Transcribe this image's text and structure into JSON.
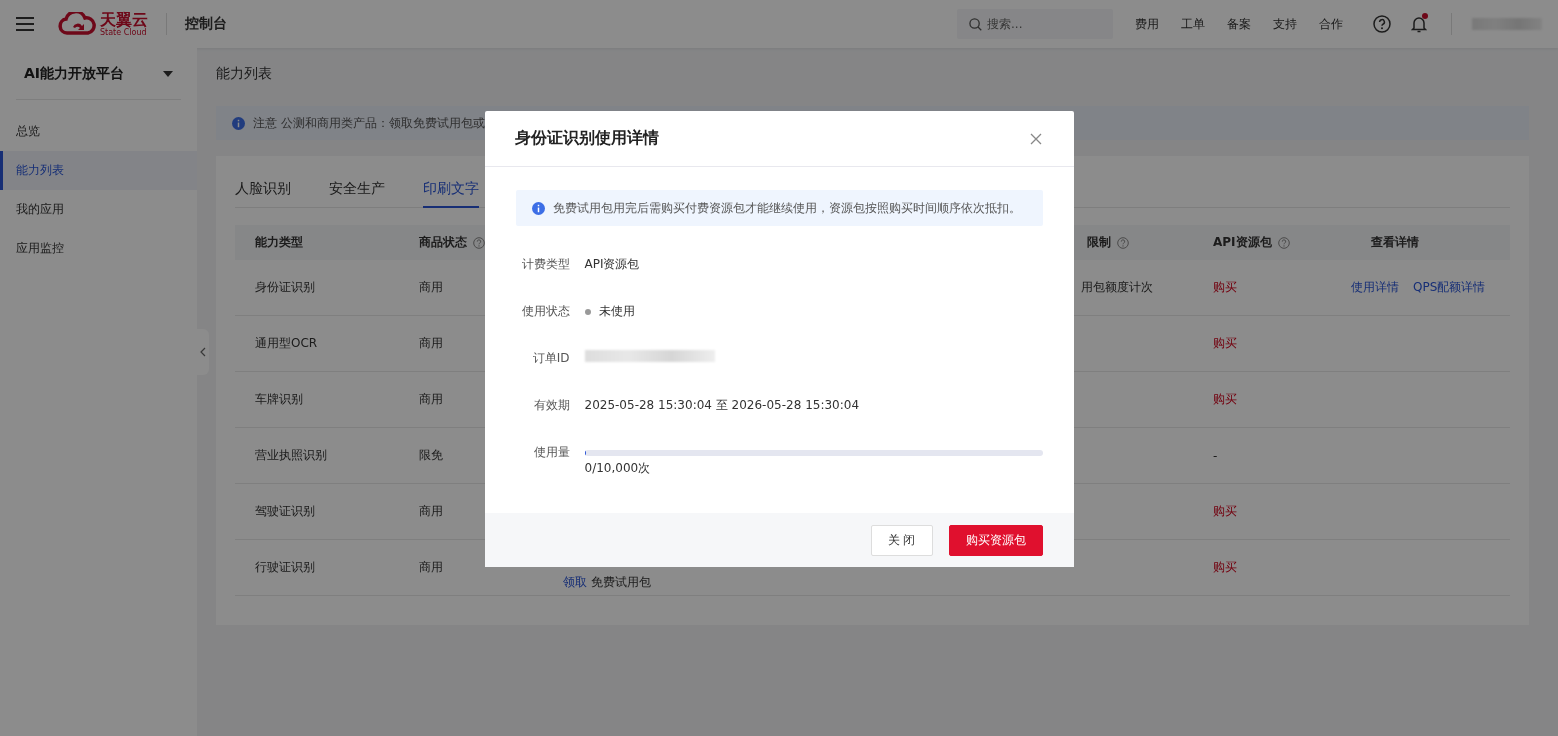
{
  "topbar": {
    "logo": {
      "name": "天翼云",
      "subtitle": "State Cloud"
    },
    "title": "控制台",
    "search": {
      "placeholder": "搜索..."
    },
    "links": [
      "费用",
      "工单",
      "备案",
      "支持",
      "合作"
    ],
    "notification": {
      "unread": true
    }
  },
  "sidebar": {
    "platform": "AI能力开放平台",
    "items": [
      {
        "label": "总览",
        "selected": false
      },
      {
        "label": "能力列表",
        "selected": true
      },
      {
        "label": "我的应用",
        "selected": false
      },
      {
        "label": "应用监控",
        "selected": false
      }
    ]
  },
  "page": {
    "title": "能力列表",
    "notice": {
      "label": "注意",
      "text": "公测和商用类产品：领取免费试用包或"
    },
    "tabs": [
      {
        "label": "人脸识别",
        "selected": false
      },
      {
        "label": "安全生产",
        "selected": false
      },
      {
        "label": "印刷文字",
        "selected": true
      }
    ],
    "table": {
      "columns": {
        "type": {
          "label": "能力类型",
          "help": false
        },
        "status": {
          "label": "商品状态",
          "help": true
        },
        "column_5": {
          "label": "限制",
          "help": true
        },
        "api_package": {
          "label": "API资源包",
          "help": true
        },
        "details": {
          "label": "查看详情",
          "help": false
        }
      },
      "rows": [
        {
          "type": "身份证识别",
          "status": "商用",
          "column_5": "用包额度计次",
          "api_package": {
            "kind": "buy",
            "text": "购买"
          },
          "details": [
            "使用详情",
            "QPS配额详情"
          ]
        },
        {
          "type": "通用型OCR",
          "status": "商用",
          "api_package": {
            "kind": "buy",
            "text": "购买"
          }
        },
        {
          "type": "车牌识别",
          "status": "商用",
          "api_package": {
            "kind": "buy",
            "text": "购买"
          }
        },
        {
          "type": "营业执照识别",
          "status": "限免",
          "api_package": {
            "kind": "text",
            "text": "-"
          }
        },
        {
          "type": "驾驶证识别",
          "status": "商用",
          "api_package": {
            "kind": "buy",
            "text": "购买"
          }
        },
        {
          "type": "行驶证识别",
          "status": "商用",
          "column_3": {
            "action": "领取",
            "text": "免费试用包"
          },
          "api_package": {
            "kind": "buy",
            "text": "购买"
          }
        }
      ]
    }
  },
  "dialog": {
    "title": "身份证识别使用详情",
    "info": "免费试用包用完后需购买付费资源包才能继续使用，资源包按照购买时间顺序依次抵扣。",
    "fields": [
      {
        "kind": "text",
        "label": "计费类型",
        "value": "API资源包"
      },
      {
        "kind": "status",
        "label": "使用状态",
        "value": "未使用",
        "color": "#999999"
      },
      {
        "kind": "redacted",
        "label": "订单ID"
      },
      {
        "kind": "text",
        "label": "有效期",
        "value": "2025-05-28 15:30:04 至 2026-05-28 15:30:04"
      },
      {
        "kind": "progress",
        "label": "使用量",
        "level": 0,
        "value": "0/10,000次"
      }
    ],
    "buttons": [
      {
        "kind": "secondary",
        "label": "关 闭"
      },
      {
        "kind": "primary",
        "label": "购买资源包"
      }
    ]
  }
}
